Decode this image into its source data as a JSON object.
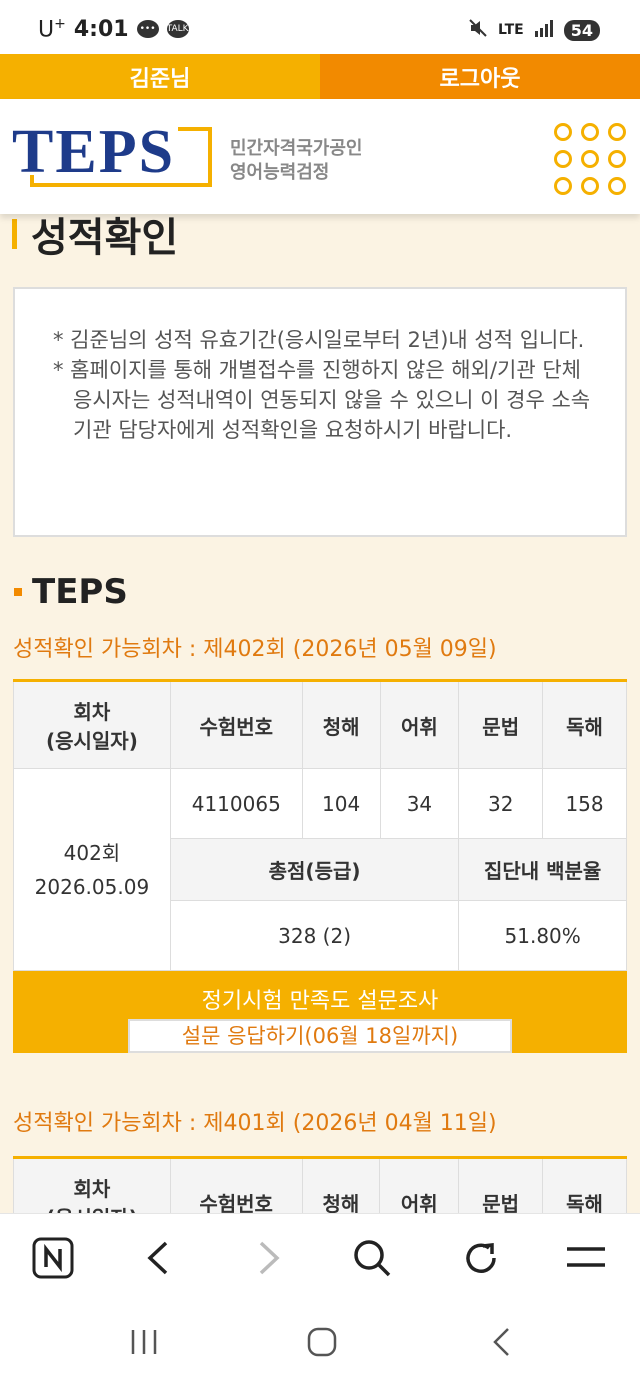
{
  "status": {
    "carrier": "U",
    "carrier_sup": "+",
    "time": "4:01",
    "talk_label": "TALK",
    "network": "LTE",
    "battery": "54"
  },
  "topnav": {
    "user": "김준님",
    "logout": "로그아웃"
  },
  "header": {
    "logo": "TEPS",
    "sub_line1": "민간자격국가공인",
    "sub_line2": "영어능력검정"
  },
  "page": {
    "title": "성적확인"
  },
  "notice": {
    "items": [
      "* 김준님의 성적 유효기간(응시일로부터 2년)내 성적 입니다.",
      "* 홈페이지를 통해 개별접수를 진행하지 않은 해외/기관 단체 응시자는 성적내역이 연동되지 않을 수 있으니 이 경우 소속 기관 담당자에게 성적확인을 요청하시기 바랍니다."
    ]
  },
  "section": {
    "title": "TEPS"
  },
  "results": [
    {
      "round_title": "성적확인 가능회차 : 제402회 (2026년 05월 09일)",
      "headers": {
        "round_line1": "회차",
        "round_line2": "(응시일자)",
        "exam_no": "수험번호",
        "listening": "청해",
        "vocab": "어휘",
        "grammar": "문법",
        "reading": "독해",
        "total": "총점(등급)",
        "percentile": "집단내 백분율"
      },
      "round": "402회",
      "date": "2026.05.09",
      "exam_no": "4110065",
      "listening": "104",
      "vocab": "34",
      "grammar": "32",
      "reading": "158",
      "total": "328 (2)",
      "percentile": "51.80%"
    },
    {
      "round_title": "성적확인 가능회차 : 제401회 (2026년 04월 11일)",
      "headers": {
        "round_line1": "회차",
        "round_line2": "(응시일자)",
        "exam_no": "수험번호",
        "listening": "청해",
        "vocab": "어휘",
        "grammar": "문법",
        "reading": "독해"
      }
    }
  ],
  "survey": {
    "title": "정기시험 만족도 설문조사",
    "button": "설문 응답하기(06월 18일까지)"
  },
  "colors": {
    "accent": "#f5b000",
    "accent_dark": "#f28a00",
    "link": "#e07a10",
    "logo_blue": "#1e3b8a"
  }
}
